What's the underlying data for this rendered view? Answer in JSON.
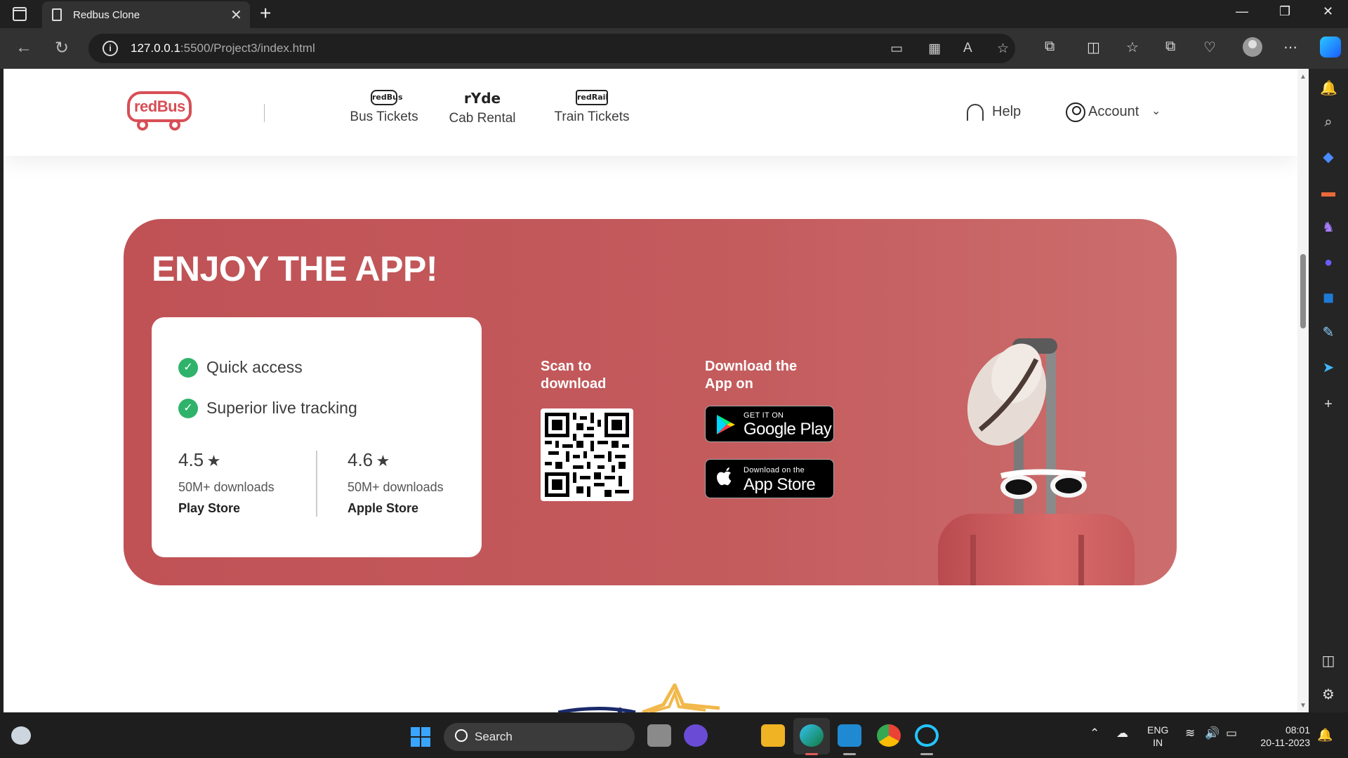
{
  "browser": {
    "tab_title": "Redbus Clone",
    "url_host": "127.0.0.1",
    "url_path": ":5500/Project3/index.html"
  },
  "header": {
    "logo_text": "redBus",
    "nav": [
      {
        "label": "Bus Tickets",
        "icon_text": "redBus"
      },
      {
        "label": "Cab Rental",
        "icon_text": "rYde"
      },
      {
        "label": "Train Tickets",
        "icon_text": "redRail"
      }
    ],
    "help_label": "Help",
    "account_label": "Account"
  },
  "banner": {
    "title": "ENJOY THE APP!",
    "features": [
      "Quick access",
      "Superior live tracking"
    ],
    "ratings": [
      {
        "value": "4.5",
        "downloads": "50M+ downloads",
        "store": "Play Store"
      },
      {
        "value": "4.6",
        "downloads": "50M+ downloads",
        "store": "Apple Store"
      }
    ],
    "scan_title": "Scan to download",
    "download_title": "Download the App on",
    "google_play": {
      "small": "GET IT ON",
      "big": "Google Play"
    },
    "app_store": {
      "small": "Download on the",
      "big": "App Store"
    }
  },
  "taskbar": {
    "search_label": "Search",
    "lang_top": "ENG",
    "lang_bottom": "IN",
    "time": "08:01",
    "date": "20-11-2023"
  },
  "colors": {
    "brand_red": "#d84e55",
    "banner_red": "#c05256",
    "check_green": "#2fb36a"
  }
}
